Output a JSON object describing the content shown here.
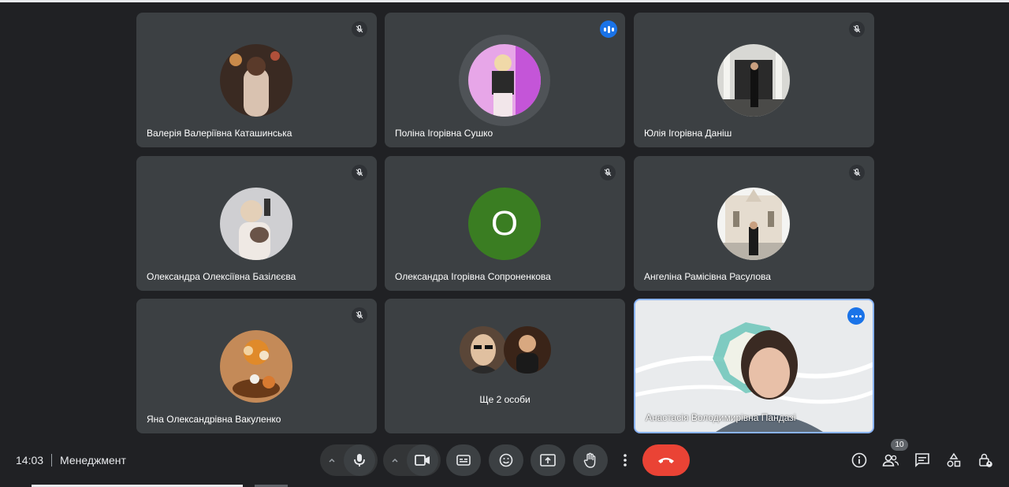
{
  "participants": [
    {
      "name": "Валерія Валеріївна Каташинська"
    },
    {
      "name": "Поліна Ігорівна Сушко"
    },
    {
      "name": "Юлія Ігорівна Даніш"
    },
    {
      "name": "Олександра Олексіївна Базілєєва"
    },
    {
      "name": "Олександра Ігорівна Сопроненкова",
      "initial": "О"
    },
    {
      "name": "Ангеліна Рамісівна Расулова"
    },
    {
      "name": "Яна Олександрівна Вакуленко"
    },
    {
      "name": "Анастасія Володимирівна Пандазі"
    }
  ],
  "others_tile": {
    "label": "Ще 2 особи"
  },
  "meeting": {
    "time": "14:03",
    "title": "Менеджмент"
  },
  "people_count": "10",
  "colors": {
    "accent": "#1a73e8",
    "end_call": "#ea4335",
    "tile": "#3c4043",
    "background": "#202124"
  }
}
